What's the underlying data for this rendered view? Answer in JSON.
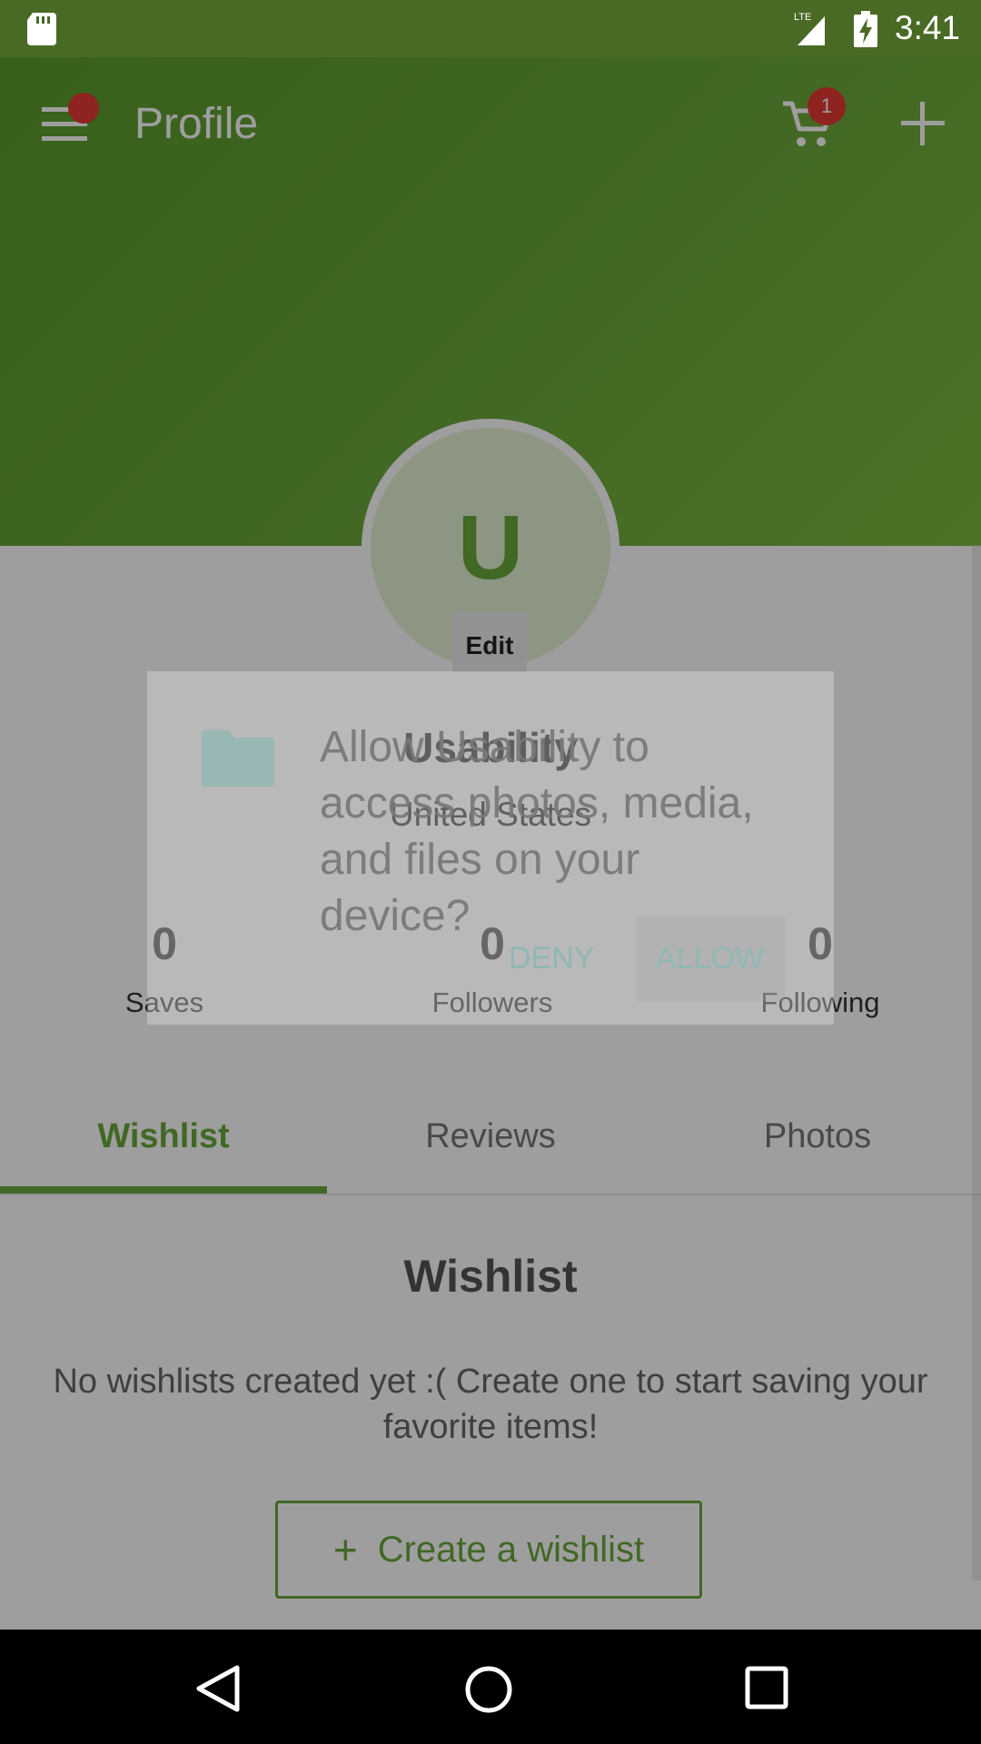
{
  "status_bar": {
    "time": "3:41",
    "network": "LTE"
  },
  "toolbar": {
    "title": "Profile",
    "cart_badge": "1"
  },
  "profile": {
    "avatar_letter": "U",
    "edit_label": "Edit",
    "name": "Usability",
    "country": "United States",
    "stats": [
      {
        "value": "0",
        "label": "Saves"
      },
      {
        "value": "0",
        "label": "Followers"
      },
      {
        "value": "0",
        "label": "Following"
      }
    ]
  },
  "tabs": [
    {
      "label": "Wishlist",
      "active": true
    },
    {
      "label": "Reviews",
      "active": false
    },
    {
      "label": "Photos",
      "active": false
    }
  ],
  "wishlist": {
    "title": "Wishlist",
    "empty_message": "No wishlists created yet :( Create one to start saving your favorite items!",
    "create_label": "Create a wishlist"
  },
  "permission_dialog": {
    "message": "Allow Usability to access photos, media, and files on your device?",
    "deny_label": "DENY",
    "allow_label": "ALLOW"
  },
  "colors": {
    "brand_green": "#6aa83a",
    "status_bar": "#496a25",
    "badge_red": "#e53935"
  }
}
